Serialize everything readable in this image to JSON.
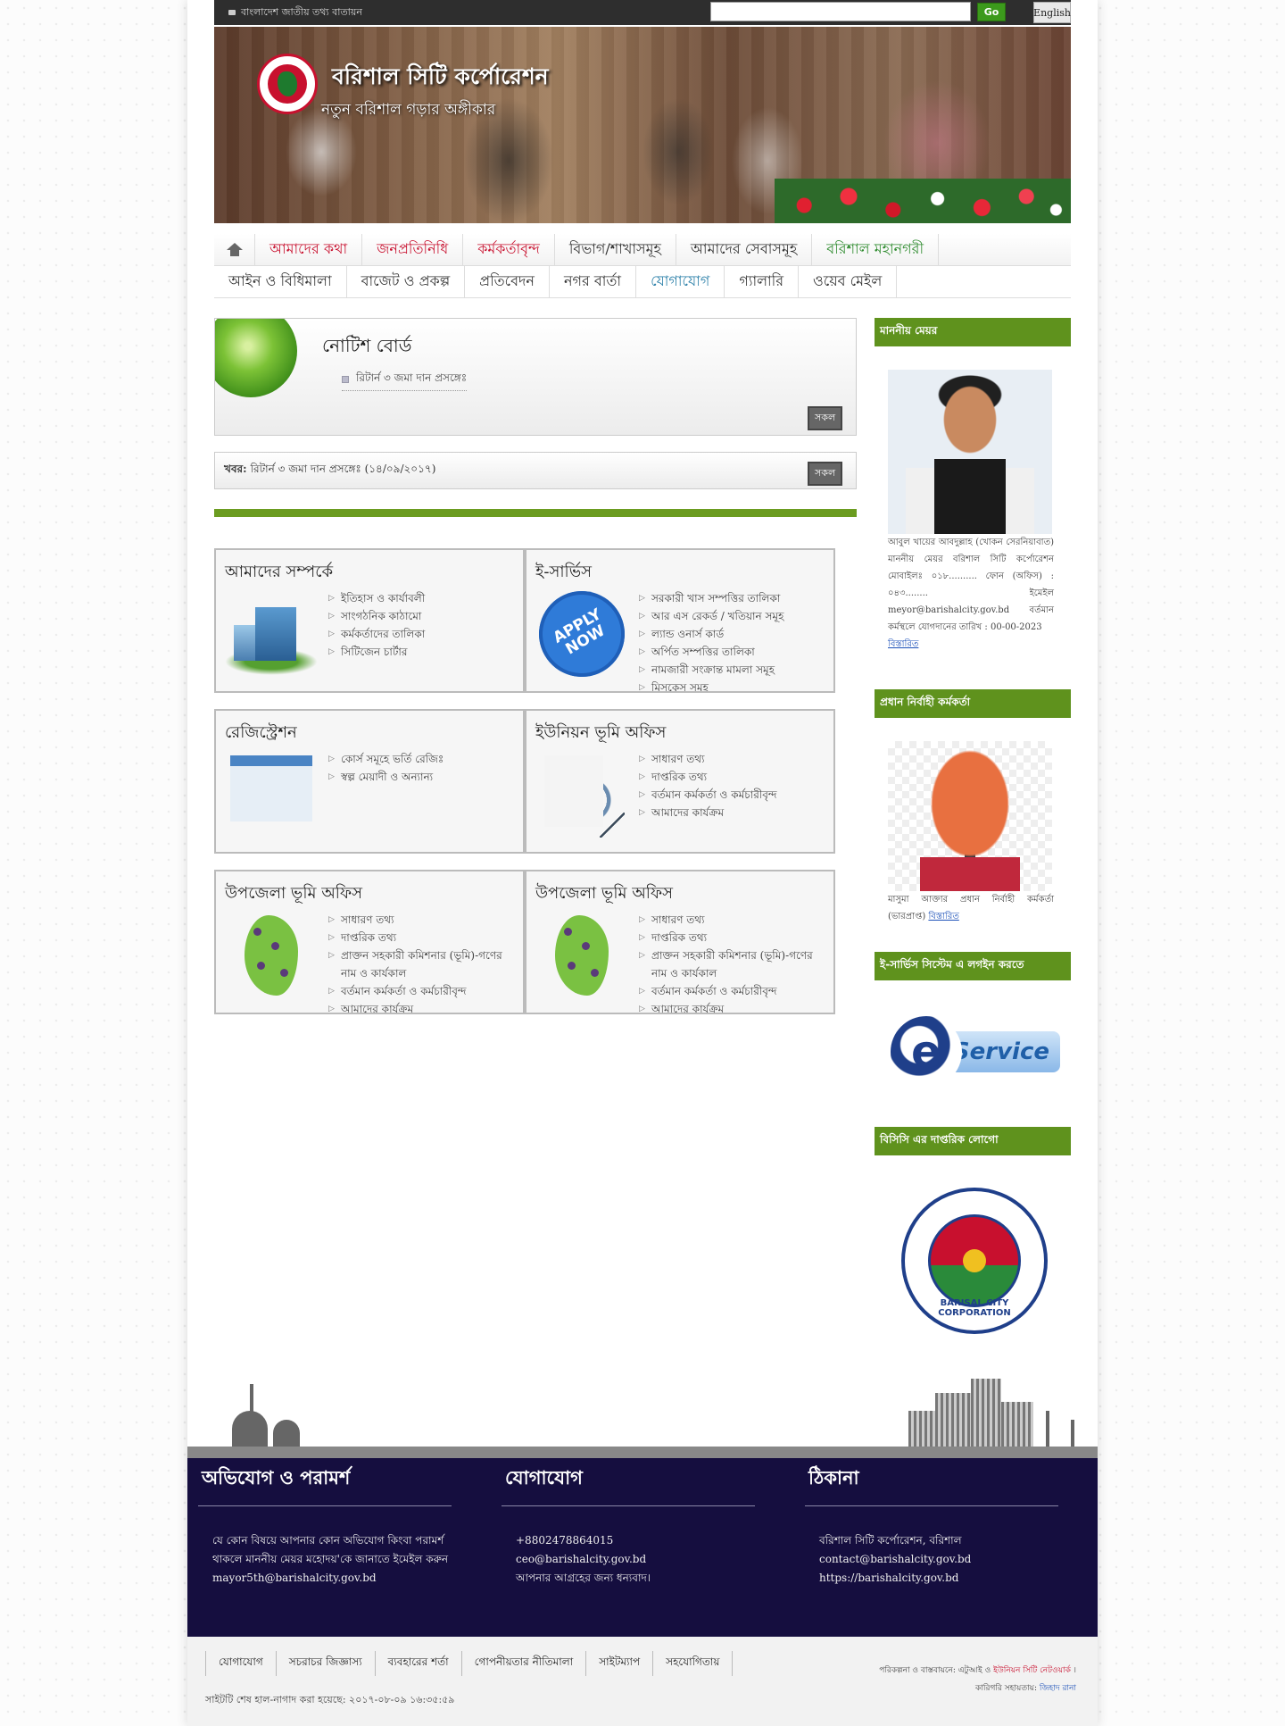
{
  "topbar": {
    "portal_label": "বাংলাদেশ জাতীয় তথ্য বাতায়ন",
    "search_placeholder": "",
    "go_label": "Go",
    "lang_label": "English"
  },
  "banner": {
    "title": "বরিশাল সিটি কর্পোরেশন",
    "tagline": "নতুন বরিশাল গড়ার অঙ্গীকার"
  },
  "nav": {
    "row1": [
      {
        "label": "আমাদের কথা",
        "color": "#c8102e"
      },
      {
        "label": "জনপ্রতিনিধি",
        "color": "#c8102e"
      },
      {
        "label": "কর্মকর্তাবৃন্দ",
        "color": "#c8102e"
      },
      {
        "label": "বিভাগ/শাখাসমূহ",
        "color": "#333333"
      },
      {
        "label": "আমাদের সেবাসমূহ",
        "color": "#333333"
      },
      {
        "label": "বরিশাল মহানগরী",
        "color": "#2e8b2e"
      }
    ],
    "row2": [
      {
        "label": "আইন ও বিধিমালা",
        "color": "#333333"
      },
      {
        "label": "বাজেট ও প্রকল্প",
        "color": "#333333"
      },
      {
        "label": "প্রতিবেদন",
        "color": "#333333"
      },
      {
        "label": "নগর বার্তা",
        "color": "#333333"
      },
      {
        "label": "যোগাযোগ",
        "color": "#2a7fa8"
      },
      {
        "label": "গ্যালারি",
        "color": "#333333"
      },
      {
        "label": "ওয়েব মেইল",
        "color": "#333333"
      }
    ]
  },
  "notice": {
    "title": "নোটিশ বোর্ড",
    "item": "রিটার্ন ৩ জমা দান প্রসঙ্গেঃ",
    "all_label": "সকল"
  },
  "news": {
    "label": "খবর:",
    "text": "রিটার্ন ৩ জমা দান প্রসঙ্গেঃ (১৪/০৯/২০১৭)",
    "all_label": "সকল"
  },
  "cards": [
    {
      "title": "আমাদের সম্পর্কে",
      "icon": "building-icon",
      "links": [
        "ইতিহাস ও কার্যাবলী",
        "সাংগঠনিক কাঠামো",
        "কর্মকর্তাদের তালিকা",
        "সিটিজেন চার্টার"
      ]
    },
    {
      "title": "ই-সার্ভিস",
      "icon": "apply-now-icon",
      "icon_text": "APPLY NOW",
      "links": [
        "সরকারী খাস সম্পত্তির তালিকা",
        "আর এস রেকর্ড / খতিয়ান সমূহ",
        "ল্যান্ড ওনার্স কার্ড",
        "অর্পিত সম্পত্তির তালিকা",
        "নামজারী সংক্রান্ত মামলা সমূহ",
        "মিসকেস সমূহ"
      ]
    },
    {
      "title": "রেজিস্ট্রেশন",
      "icon": "form-icon",
      "links": [
        "কোর্স সমূহে ভর্তি রেজিঃ",
        "স্বল্প মেয়াদী ও অন্যান্য"
      ]
    },
    {
      "title": "ইউনিয়ন ভূমি অফিস",
      "icon": "results-icon",
      "links": [
        "সাধারণ তথ্য",
        "দাপ্তরিক তথ্য",
        "বর্তমান কর্মকর্তা ও কর্মচারীবৃন্দ",
        "আমাদের কার্যক্রম"
      ]
    },
    {
      "title": "উপজেলা ভূমি অফিস",
      "icon": "bangladesh-map-icon",
      "links": [
        "সাধারণ তথ্য",
        "দাপ্তরিক তথ্য",
        "প্রাক্তন সহকারী কমিশনার (ভূমি)-গণের নাম ও কার্যকাল",
        "বর্তমান কর্মকর্তা ও কর্মচারীবৃন্দ",
        "আমাদের কার্যক্রম"
      ]
    },
    {
      "title": "উপজেলা ভূমি অফিস",
      "icon": "bangladesh-map-icon",
      "links": [
        "সাধারণ তথ্য",
        "দাপ্তরিক তথ্য",
        "প্রাক্তন সহকারী কমিশনার (ভূমি)-গণের নাম ও কার্যকাল",
        "বর্তমান কর্মকর্তা ও কর্মচারীবৃন্দ",
        "আমাদের কার্যক্রম"
      ]
    }
  ],
  "sidebar": {
    "mayor_head": "মাননীয় মেয়র",
    "mayor_text": "আবুল খায়ের আবদুল্লাহ (খোকন সেরনিয়াবাত) মাননীয় মেয়র বরিশাল সিটি কর্পোরেশন মোবাইলঃ ০১৮.......... ফোন (অফিস) : ০৪৩........ ইমেইল meyor@barishalcity.gov.bd বর্তমান কর্মস্থলে যোগদানের তারিখ : 00-00-2023",
    "mayor_more": "বিস্তারিত",
    "ceo_head": "প্রধান নির্বাহী কর্মকর্তা",
    "ceo_text": "মাসুমা আক্তার প্রধান নির্বাহী কর্মকর্তা (ভারপ্রাপ্ত)",
    "ceo_more": "বিস্তারিত",
    "eservice_head": "ই-সার্ভিস সিস্টেম এ লগইন করতে",
    "eservice_letter": "e",
    "eservice_label": "Service",
    "logo_head": "বিসিসি এর দাপ্তরিক লোগো",
    "logo_caption": "BARISAL CITY CORPORATION"
  },
  "footer": {
    "complaint_title": "অভিযোগ ও পরামর্শ",
    "complaint_text": "যে কোন বিষয়ে আপনার কোন অভিযোগ কিংবা পরামর্শ থাকলে মাননীয় মেয়র মহোদয়'কে জানাতে ইমেইল করুন mayor5th@barishalcity.gov.bd",
    "contact_title": "যোগাযোগ",
    "contact_phone": "+8802478864015",
    "contact_email": "ceo@barishalcity.gov.bd",
    "contact_thanks": "আপনার আগ্রহের জন্য ধন্যবাদ।",
    "address_title": "ঠিকানা",
    "address_line1": "বরিশাল সিটি কর্পোরেশন, বরিশাল",
    "address_line2": "contact@barishalcity.gov.bd",
    "address_line3": "https://barishalcity.gov.bd"
  },
  "bottom": {
    "links": [
      "যোগাযোগ",
      "সচরাচর জিজ্ঞাস্য",
      "ব্যবহারের শর্তা",
      "গোপনীয়তার নীতিমালা",
      "সাইটম্যাপ",
      "সহযোগিতায়"
    ],
    "updated": "সাইটটি শেষ হাল-নাগাদ করা হয়েছে: ২০১৭-০৮-০৯ ১৬:৩৫:৫৯",
    "credit_prefix": "পরিকল্পনা ও বাস্তবায়নে: এটুআই ও",
    "credit_org": "ইউনিয়ন সিটি নেটওয়ার্ক",
    "credit_tech_prefix": "কারিগরি সহায়তায়:",
    "credit_tech": "জিহাদ রানা"
  }
}
